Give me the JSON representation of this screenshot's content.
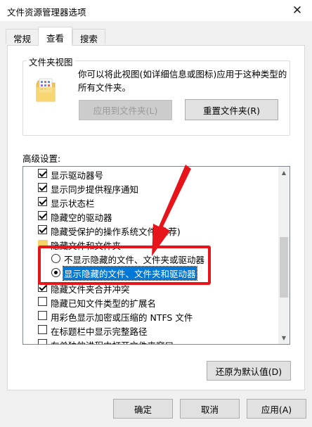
{
  "window": {
    "title": "文件资源管理器选项",
    "close_glyph": "✕"
  },
  "tabs": [
    {
      "label": "常规"
    },
    {
      "label": "查看"
    },
    {
      "label": "搜索"
    }
  ],
  "folder_views": {
    "label": "文件夹视图",
    "description": "你可以将此视图(如详细信息或图标)应用于这种类型的所有文件夹。",
    "apply_button": "应用到文件夹(L)",
    "reset_button": "重置文件夹(R)"
  },
  "advanced": {
    "label": "高级设置:",
    "items": [
      {
        "type": "checkbox",
        "label": "显示驱动器号",
        "checked": true
      },
      {
        "type": "checkbox",
        "label": "显示同步提供程序通知",
        "checked": true
      },
      {
        "type": "checkbox",
        "label": "显示状态栏",
        "checked": true
      },
      {
        "type": "checkbox",
        "label": "隐藏空的驱动器",
        "checked": true
      },
      {
        "type": "checkbox",
        "label": "隐藏受保护的操作系统文件(推荐)",
        "checked": true
      },
      {
        "type": "folder",
        "label": "隐藏文件和文件夹"
      },
      {
        "type": "radio",
        "label": "不显示隐藏的文件、文件夹或驱动器",
        "selected": false
      },
      {
        "type": "radio",
        "label": "显示隐藏的文件、文件夹和驱动器",
        "selected": true
      },
      {
        "type": "checkbox",
        "label": "隐藏文件夹合并冲突",
        "checked": true
      },
      {
        "type": "checkbox",
        "label": "隐藏已知文件类型的扩展名",
        "checked": false
      },
      {
        "type": "checkbox",
        "label": "用彩色显示加密或压缩的 NTFS 文件",
        "checked": false
      },
      {
        "type": "checkbox",
        "label": "在标题栏中显示完整路径",
        "checked": false
      },
      {
        "type": "checkbox",
        "label": "在单独的进程中打开文件夹窗口",
        "checked": false
      }
    ]
  },
  "buttons": {
    "restore_defaults": "还原为默认值(D)",
    "ok": "确定",
    "cancel": "取消",
    "apply": "应用(A)"
  },
  "scroll": {
    "up_glyph": "▲",
    "down_glyph": "▼"
  },
  "colors": {
    "annotation": "#e8141b",
    "selection": "#0078d7"
  }
}
